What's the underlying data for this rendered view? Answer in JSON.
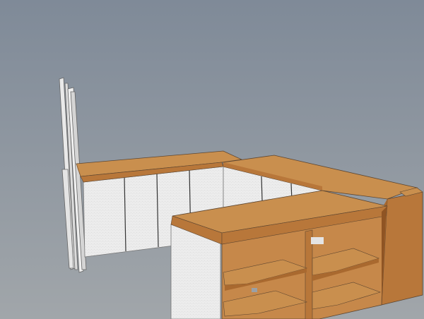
{
  "viewport": {
    "background_top": "#7f8a98",
    "background_bottom": "#a1a6aa"
  },
  "materials": {
    "wood_top": "#c98f4e",
    "wood_front": "#b8773a",
    "wood_side": "#a9692f",
    "wood_inner": "#c6884a",
    "wood_dark": "#8f5423",
    "panel_white": "#ececec",
    "panel_shade": "#d8d8d8",
    "edge_line": "#5e4630"
  }
}
